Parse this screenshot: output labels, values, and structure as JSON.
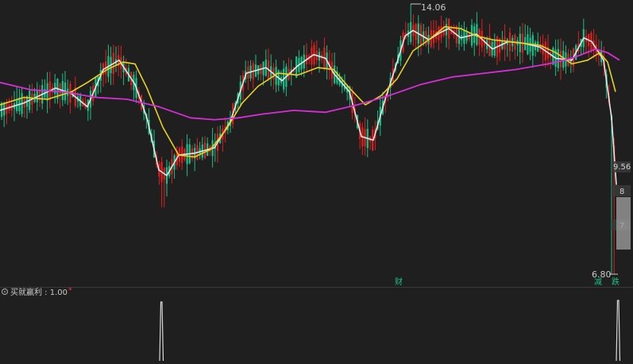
{
  "colors": {
    "background": "#1f1f1f",
    "up_candle": "#e0201f",
    "down_candle": "#19c08a",
    "ma_white": "#e6e6e6",
    "ma_yellow": "#e8d21e",
    "ma_magenta": "#d42fd4",
    "indicator_line": "#d8d8d8",
    "accent_red": "#ff3b3b",
    "marker_text": "#19c08a",
    "label_text": "#c8c8c8"
  },
  "labels": {
    "high_price": "14.06",
    "low_price": "6.80",
    "right_tick_1": "9.56",
    "right_tick_2": "8",
    "right_tick_3": "7.",
    "event_markers": [
      "财 ",
      "减",
      "跌"
    ],
    "indicator_title": "买就赢利 : 1.00",
    "indicator_title_mark": "*"
  },
  "chart_data": [
    {
      "type": "candlestick",
      "title": "",
      "ylim": [
        6.8,
        14.06
      ],
      "annotations": [
        "14.06",
        "6.80",
        "财 ",
        "减",
        "跌"
      ],
      "right_axis_ticks": [
        "9.56",
        "8",
        "7."
      ],
      "ma_series": [
        {
          "name": "",
          "color": "#e6e6e6",
          "points": [
            [
              0,
              11.2
            ],
            [
              30,
              11.4
            ],
            [
              50,
              11.6
            ],
            [
              70,
              11.8
            ],
            [
              90,
              11.65
            ],
            [
              110,
              11.3
            ],
            [
              130,
              12.3
            ],
            [
              150,
              12.55
            ],
            [
              170,
              11.9
            ],
            [
              185,
              11.0
            ],
            [
              200,
              9.6
            ],
            [
              210,
              9.45
            ],
            [
              225,
              10.0
            ],
            [
              245,
              10.05
            ],
            [
              270,
              10.2
            ],
            [
              290,
              10.9
            ],
            [
              310,
              12.2
            ],
            [
              335,
              12.35
            ],
            [
              355,
              12.0
            ],
            [
              375,
              12.4
            ],
            [
              395,
              12.7
            ],
            [
              410,
              12.6
            ],
            [
              420,
              12.2
            ],
            [
              440,
              11.7
            ],
            [
              455,
              10.5
            ],
            [
              470,
              10.4
            ],
            [
              485,
              11.5
            ],
            [
              500,
              12.5
            ],
            [
              510,
              13.2
            ],
            [
              520,
              13.35
            ],
            [
              540,
              13.1
            ],
            [
              555,
              13.3
            ],
            [
              565,
              13.4
            ],
            [
              580,
              13.15
            ],
            [
              600,
              13.25
            ],
            [
              620,
              12.85
            ],
            [
              640,
              13.05
            ],
            [
              660,
              13.0
            ],
            [
              680,
              12.9
            ],
            [
              700,
              12.6
            ],
            [
              720,
              12.55
            ],
            [
              735,
              13.15
            ],
            [
              745,
              13.05
            ],
            [
              760,
              12.55
            ],
            [
              770,
              11.0
            ],
            [
              776,
              9.2
            ]
          ]
        },
        {
          "name": "",
          "color": "#e8d21e",
          "points": [
            [
              0,
              11.35
            ],
            [
              30,
              11.55
            ],
            [
              60,
              11.5
            ],
            [
              90,
              11.7
            ],
            [
              110,
              11.95
            ],
            [
              135,
              12.3
            ],
            [
              155,
              12.5
            ],
            [
              170,
              12.45
            ],
            [
              185,
              11.8
            ],
            [
              205,
              10.75
            ],
            [
              225,
              10.0
            ],
            [
              245,
              9.95
            ],
            [
              265,
              10.15
            ],
            [
              285,
              10.7
            ],
            [
              305,
              11.4
            ],
            [
              325,
              11.85
            ],
            [
              350,
              12.2
            ],
            [
              375,
              12.15
            ],
            [
              400,
              12.35
            ],
            [
              420,
              12.3
            ],
            [
              440,
              11.8
            ],
            [
              460,
              11.35
            ],
            [
              480,
              11.6
            ],
            [
              500,
              12.05
            ],
            [
              520,
              12.8
            ],
            [
              540,
              13.1
            ],
            [
              560,
              13.45
            ],
            [
              580,
              13.4
            ],
            [
              600,
              13.2
            ],
            [
              620,
              13.1
            ],
            [
              640,
              13.05
            ],
            [
              660,
              13.0
            ],
            [
              680,
              12.95
            ],
            [
              700,
              12.75
            ],
            [
              720,
              12.45
            ],
            [
              740,
              12.55
            ],
            [
              755,
              12.75
            ],
            [
              765,
              12.5
            ],
            [
              775,
              11.7
            ]
          ]
        },
        {
          "name": "",
          "color": "#d42fd4",
          "points": [
            [
              0,
              11.95
            ],
            [
              40,
              11.75
            ],
            [
              80,
              11.7
            ],
            [
              120,
              11.55
            ],
            [
              160,
              11.5
            ],
            [
              200,
              11.3
            ],
            [
              240,
              11.0
            ],
            [
              270,
              10.95
            ],
            [
              300,
              11.0
            ],
            [
              330,
              11.1
            ],
            [
              370,
              11.2
            ],
            [
              410,
              11.15
            ],
            [
              450,
              11.35
            ],
            [
              490,
              11.6
            ],
            [
              530,
              11.9
            ],
            [
              570,
              12.1
            ],
            [
              610,
              12.2
            ],
            [
              650,
              12.3
            ],
            [
              690,
              12.45
            ],
            [
              720,
              12.6
            ],
            [
              750,
              12.85
            ],
            [
              765,
              12.75
            ],
            [
              780,
              12.55
            ]
          ]
        }
      ]
    },
    {
      "type": "line",
      "title": "买就赢利 : 1.00",
      "note": "signal indicator: baseline with sharp spikes",
      "spike_x_px_note": "spikes occur at bars near the 9.45 low and the final 6.80 drop",
      "series": [
        {
          "name": "",
          "values": [
            0,
            0,
            1,
            0,
            0,
            0,
            1,
            0
          ]
        }
      ]
    }
  ]
}
